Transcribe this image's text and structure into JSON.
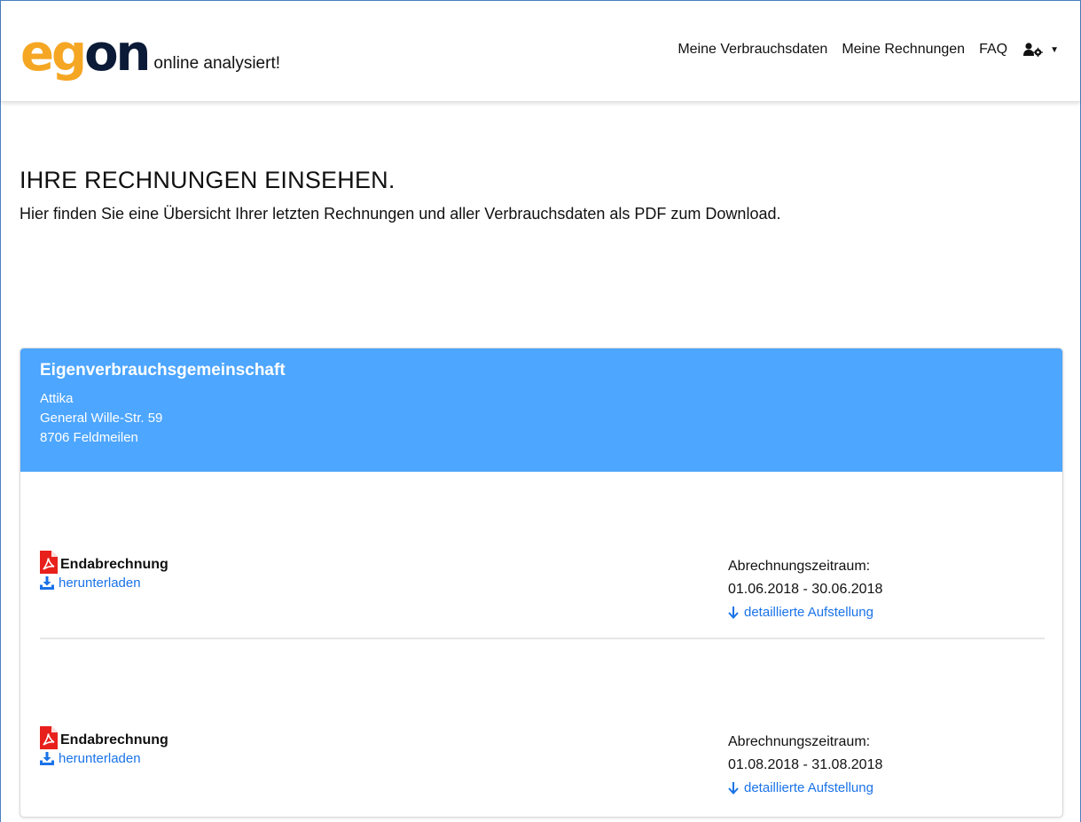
{
  "header": {
    "logo_part1": "eg",
    "logo_part2": "on",
    "tagline": "online analysiert!",
    "nav": [
      "Meine Verbrauchsdaten",
      "Meine Rechnungen",
      "FAQ"
    ]
  },
  "page": {
    "title": "IHRE RECHNUNGEN EINSEHEN.",
    "subtitle": "Hier finden Sie eine Übersicht Ihrer letzten Rechnungen und aller Verbrauchsdaten als PDF zum Download."
  },
  "card": {
    "name": "Eigenverbrauchsgemeinschaft",
    "address": [
      "Attika",
      "General Wille-Str. 59",
      "8706 Feldmeilen"
    ],
    "invoices": [
      {
        "label": "Endabrechnung",
        "download": "herunterladen",
        "period_label": "Abrechnungszeitraum:",
        "period": "01.06.2018 - 30.06.2018",
        "detail": "detaillierte Aufstellung"
      },
      {
        "label": "Endabrechnung",
        "download": "herunterladen",
        "period_label": "Abrechnungszeitraum:",
        "period": "01.08.2018 - 31.08.2018",
        "detail": "detaillierte Aufstellung"
      }
    ]
  },
  "colors": {
    "accent": "#4da6ff",
    "link": "#1a73e8",
    "logo_orange": "#f5a623",
    "logo_navy": "#0b1a36",
    "pdf_red": "#e8201c"
  },
  "icons": [
    "pdf-icon",
    "download-icon",
    "arrow-down-icon",
    "user-cog-icon",
    "caret-down-icon"
  ]
}
